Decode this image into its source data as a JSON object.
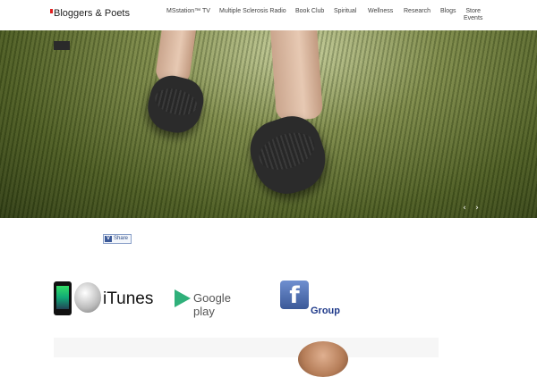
{
  "header": {
    "logo_text": "Bloggers & Poets",
    "nav": [
      {
        "label": "MSstation™ TV"
      },
      {
        "label": "Multiple Sclerosis Radio"
      },
      {
        "label": "Book Club"
      },
      {
        "label": "Spiritual"
      },
      {
        "label": "Wellness"
      },
      {
        "label": "Research"
      },
      {
        "label": "Blogs"
      },
      {
        "label": "Store",
        "sub": "Events"
      }
    ]
  },
  "slider": {
    "prev_icon": "chevron-left-icon",
    "next_icon": "chevron-right-icon"
  },
  "share": {
    "label": "Share",
    "icon_letter": "V"
  },
  "badges": {
    "itunes": "iTunes",
    "google_play": "Google play",
    "facebook_letter": "f",
    "facebook_group": "Group"
  },
  "colors": {
    "logo_accent": "#e02020",
    "facebook_blue": "#3b5998",
    "google_play_green": "#2fb07a"
  }
}
